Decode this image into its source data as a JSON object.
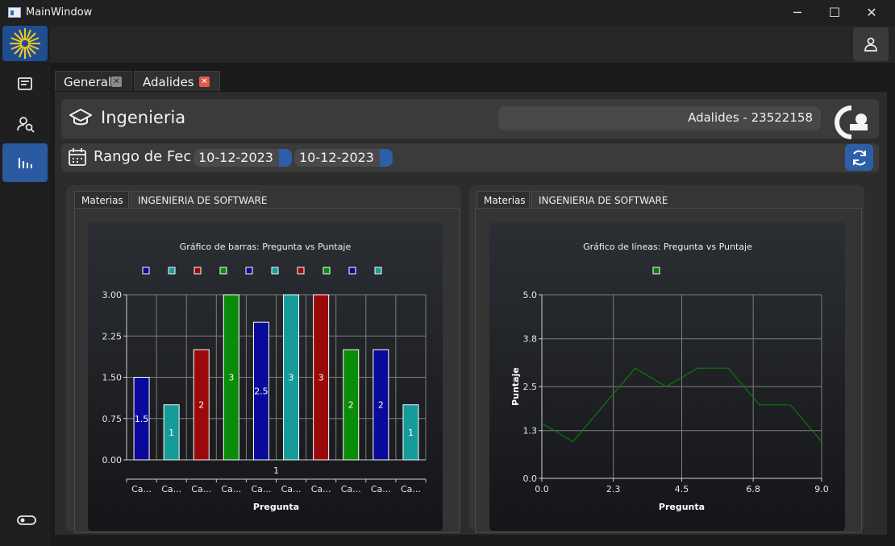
{
  "window": {
    "title": "MainWindow",
    "minimize_glyph": "─",
    "maximize_glyph": "☐",
    "close_glyph": "✕"
  },
  "sidebar": {
    "logo": "university-logo",
    "items": [
      {
        "name": "sidebar-item-forms",
        "icon": "form-icon"
      },
      {
        "name": "sidebar-item-search-user",
        "icon": "search-user-icon"
      },
      {
        "name": "sidebar-item-stats",
        "icon": "bar-chart-icon",
        "active": true
      },
      {
        "name": "sidebar-item-theme-toggle",
        "icon": "toggle-icon"
      }
    ]
  },
  "tabs": [
    {
      "label": "General",
      "close": "✕",
      "active": false
    },
    {
      "label": "Adalides",
      "close": "✕",
      "active": true
    }
  ],
  "header": {
    "title": "Ingenieria",
    "user_field": "Adalides  - 23522158"
  },
  "date_range": {
    "label": "Rango de Fechas",
    "start": "10-12-2023",
    "end": "10-12-2023"
  },
  "colors": {
    "accent": "#2d5fa8",
    "close_red": "#e05a4a",
    "grid": "#8a8a8a"
  },
  "left_panel": {
    "tab_materias": "Materias",
    "tab_subject": "INGENIERIA DE SOFTWARE"
  },
  "right_panel": {
    "tab_materias": "Materias",
    "tab_subject": "INGENIERIA DE SOFTWARE"
  },
  "chart_data": [
    {
      "type": "bar",
      "title": "Gráfico de barras: Pregunta vs Puntaje",
      "xlabel": "Pregunta",
      "ylabel": "",
      "ylim": [
        0,
        3
      ],
      "yticks": [
        "0.00",
        "0.75",
        "1.50",
        "2.25",
        "3.00"
      ],
      "category_group": "1",
      "categories": [
        "Ca...",
        "Ca...",
        "Ca...",
        "Ca...",
        "Ca...",
        "Ca...",
        "Ca...",
        "Ca...",
        "Ca...",
        "Ca..."
      ],
      "values": [
        1.5,
        1,
        2,
        3,
        2.5,
        3,
        3,
        2,
        2,
        1
      ],
      "labels": [
        "1.5",
        "1",
        "2",
        "3",
        "2.5",
        "3",
        "3",
        "2",
        "2",
        "1"
      ],
      "colors": [
        "#0a0a9a",
        "#169b9b",
        "#9b0a0a",
        "#0a8c0a",
        "#0a0a9a",
        "#169b9b",
        "#9b0a0a",
        "#0a8c0a",
        "#0a0a9a",
        "#169b9b"
      ],
      "legend_placement": "top",
      "grid": true
    },
    {
      "type": "line",
      "title": "Gráfico de líneas: Pregunta vs Puntaje",
      "xlabel": "Pregunta",
      "ylabel": "Puntaje",
      "xlim": [
        0,
        9
      ],
      "ylim": [
        0,
        5
      ],
      "xticks": [
        "0.0",
        "2.3",
        "4.5",
        "6.8",
        "9.0"
      ],
      "yticks": [
        "0.0",
        "1.3",
        "2.5",
        "3.8",
        "5.0"
      ],
      "x": [
        0,
        1,
        2,
        3,
        4,
        5,
        6,
        7,
        8,
        9
      ],
      "y": [
        1.5,
        1,
        2,
        3,
        2.5,
        3,
        3,
        2,
        2,
        1
      ],
      "line_color": "#0a7a0a",
      "legend_placement": "top",
      "grid": true
    }
  ]
}
